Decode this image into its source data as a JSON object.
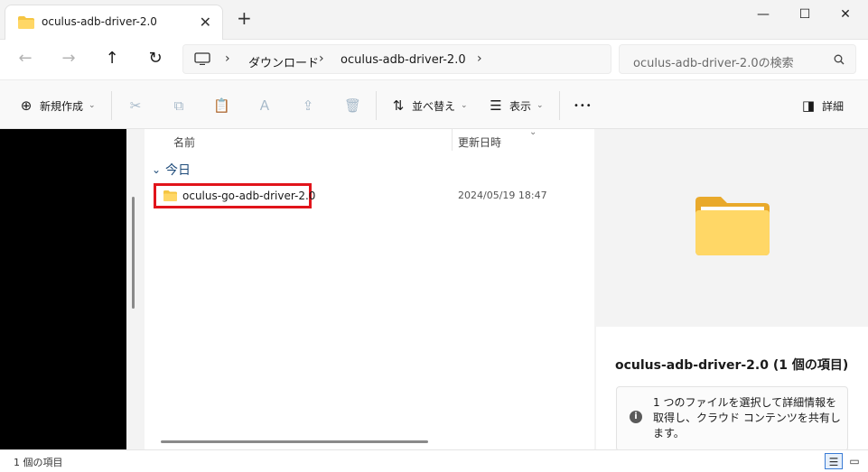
{
  "window": {
    "tab_title": "oculus-adb-driver-2.0",
    "tab_close": "✕",
    "new_tab": "+",
    "minimize": "—",
    "maximize": "☐",
    "close": "✕"
  },
  "nav": {
    "back_icon": "←",
    "forward_icon": "→",
    "up_icon": "↑",
    "refresh_icon": "↻",
    "breadcrumbs": [
      "ダウンロード",
      "oculus-adb-driver-2.0"
    ],
    "search_placeholder": "oculus-adb-driver-2.0の検索"
  },
  "toolbar": {
    "new_label": "新規作成",
    "sort_label": "並べ替え",
    "view_label": "表示",
    "more_label": "•••",
    "details_label": "詳細"
  },
  "columns": {
    "name": "名前",
    "modified": "更新日時"
  },
  "files": {
    "group_label": "今日",
    "rows": [
      {
        "name": "oculus-go-adb-driver-2.0",
        "modified": "2024/05/19 18:47"
      }
    ]
  },
  "preview": {
    "title": "oculus-adb-driver-2.0 (1 個の項目)",
    "info_icon": "i",
    "info_text": "1 つのファイルを選択して詳細情報を取得し、クラウド コンテンツを共有します。"
  },
  "status": {
    "item_count": "1 個の項目"
  },
  "colors": {
    "highlight_border": "#e1141b",
    "folder_yellow": "#f5c542",
    "accent": "#3a7bd5"
  }
}
